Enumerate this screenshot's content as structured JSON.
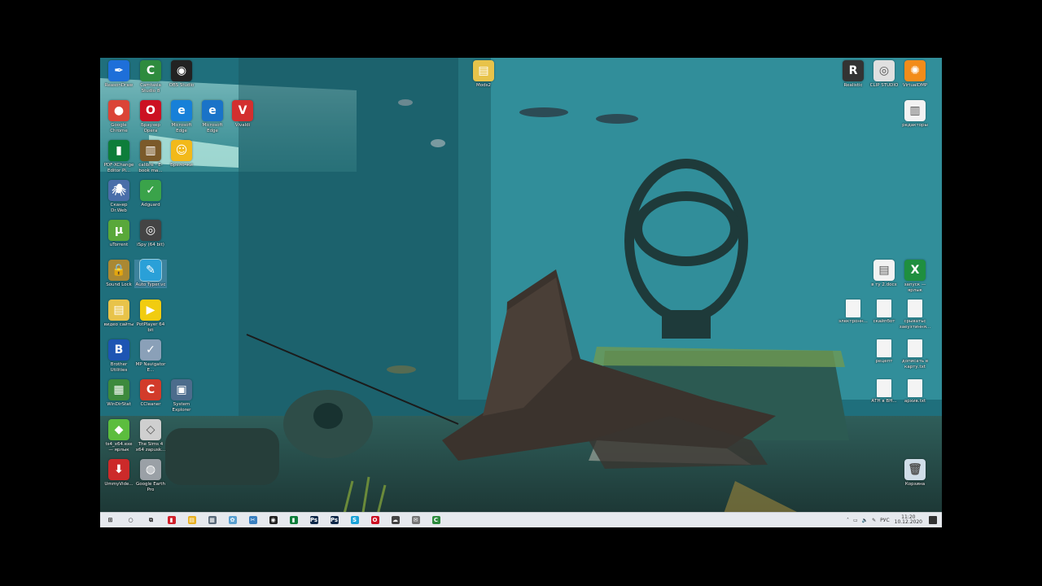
{
  "desktop": {
    "left_icons": [
      {
        "name": "Reason icon",
        "label": "ReasonDraw",
        "color": "#1e6fd9",
        "glyph": "✒"
      },
      {
        "name": "Camtasia",
        "label": "Camtasia Studio 8",
        "color": "#2e8b3e",
        "glyph": "C"
      },
      {
        "name": "OBS",
        "label": "OBS Studio",
        "color": "#222222",
        "glyph": "◉"
      },
      {
        "name": "Chrome",
        "label": "Google Chrome",
        "color": "#db4437",
        "glyph": "●"
      },
      {
        "name": "Opera",
        "label": "Браузер Opera",
        "color": "#cc1122",
        "glyph": "O"
      },
      {
        "name": "Edge",
        "label": "Microsoft Edge",
        "color": "#1780d8",
        "glyph": "e"
      },
      {
        "name": "IE",
        "label": "Microsoft Edge",
        "color": "#1a73c8",
        "glyph": "e"
      },
      {
        "name": "Vivaldi",
        "label": "Vivaldi",
        "color": "#d32f2f",
        "glyph": "V"
      },
      {
        "name": "Foxit",
        "label": "PDF-XChange Editor Pl...",
        "color": "#0d7d3a",
        "glyph": "▮"
      },
      {
        "name": "Calibre",
        "label": "calibre - E-book ma...",
        "color": "#7b5a2a",
        "glyph": "▥"
      },
      {
        "name": "Smile",
        "label": "Брелочки",
        "color": "#f2b91a",
        "glyph": "☺"
      },
      {
        "name": "DrWeb",
        "label": "Сканер Dr.Web",
        "color": "#4a6ea9",
        "glyph": "🕷"
      },
      {
        "name": "Adguard",
        "label": "Adguard",
        "color": "#3aa34a",
        "glyph": "✓"
      },
      {
        "name": "uTorrent",
        "label": "uTorrent",
        "color": "#59a83a",
        "glyph": "µ"
      },
      {
        "name": "iSpy",
        "label": "iSpy (64 bit)",
        "color": "#444444",
        "glyph": "◎"
      },
      {
        "name": "SoundLock",
        "label": "Sound Lock",
        "color": "#aa8833",
        "glyph": "🔒"
      },
      {
        "name": "AutoTyper",
        "label": "Auto Typer.vc",
        "color": "#2aa0d8",
        "glyph": "✎"
      },
      {
        "name": "VideoFolder",
        "label": "видео сайты",
        "color": "#e8c34a",
        "glyph": "▤"
      },
      {
        "name": "PotPlayer",
        "label": "PotPlayer 64 bit",
        "color": "#f1cc10",
        "glyph": "▶"
      },
      {
        "name": "Brother",
        "label": "Brother Utilities",
        "color": "#1d55b3",
        "glyph": "B"
      },
      {
        "name": "MP",
        "label": "MP Navigator E...",
        "color": "#8aa0b8",
        "glyph": "✓"
      },
      {
        "name": "WinDirStat",
        "label": "WinDirStat",
        "color": "#3d8a3d",
        "glyph": "▦"
      },
      {
        "name": "CCleaner",
        "label": "CCleaner",
        "color": "#d23b2a",
        "glyph": "C"
      },
      {
        "name": "SysExplorer",
        "label": "System Explorer",
        "color": "#4c6c8c",
        "glyph": "▣"
      },
      {
        "name": "Sims1",
        "label": "ts4_x64.exe — ярлык",
        "color": "#5cbd3e",
        "glyph": "◆"
      },
      {
        "name": "Sims2",
        "label": "The Sims 4 x64 zapusk...",
        "color": "#cfcfcf",
        "glyph": "◇"
      },
      {
        "name": "UmmyVideo",
        "label": "UmmyVide...",
        "color": "#cc2a2a",
        "glyph": "⬇"
      },
      {
        "name": "GoogleEarth",
        "label": "Google Earth Pro",
        "color": "#9aa0a6",
        "glyph": "◍"
      }
    ],
    "top_center_icon": {
      "label": "Mods2",
      "glyph": "▤",
      "color": "#e8c34a"
    },
    "right_icons": [
      {
        "name": "Reaper",
        "label": "Realistic",
        "color": "#333333",
        "glyph": "R"
      },
      {
        "name": "ClipStudio",
        "label": "CLIP STUDIO",
        "color": "#e0e0e0",
        "glyph": "◎"
      },
      {
        "name": "VirtualDub",
        "label": "VirtualDMP",
        "color": "#f28c1a",
        "glyph": "✺"
      },
      {
        "name": "Redaktor",
        "label": "редакторы",
        "color": "#f2f2f2",
        "glyph": "▥"
      },
      {
        "name": "Docx1",
        "label": "в ту 2.docx",
        "color": "#f2f2f2",
        "glyph": "▤"
      },
      {
        "name": "Xls1",
        "label": "запуск — ярлык",
        "color": "#1f8f3f",
        "glyph": "X"
      },
      {
        "name": "File1",
        "label": "электронн...",
        "color": "#f4f4f4",
        "glyph": ""
      },
      {
        "name": "File2",
        "label": "скайпбот",
        "color": "#f4f4f4",
        "glyph": ""
      },
      {
        "name": "File3",
        "label": "срыватьс заеузтиння...",
        "color": "#f4f4f4",
        "glyph": ""
      },
      {
        "name": "File4",
        "label": "рецепт",
        "color": "#f4f4f4",
        "glyph": ""
      },
      {
        "name": "File5",
        "label": "дописать в карту.txt",
        "color": "#f4f4f4",
        "glyph": ""
      },
      {
        "name": "File6",
        "label": "АТН в ВН...",
        "color": "#f4f4f4",
        "glyph": ""
      },
      {
        "name": "File7",
        "label": "архив.txt",
        "color": "#f4f4f4",
        "glyph": ""
      },
      {
        "name": "Recycle",
        "label": "Корзина",
        "color": "#d0dde8",
        "glyph": "🗑"
      }
    ]
  },
  "taskbar": {
    "items": [
      {
        "name": "start",
        "glyph": "⊞",
        "color": "#1c1c1c"
      },
      {
        "name": "search",
        "glyph": "○",
        "color": "#1c1c1c"
      },
      {
        "name": "taskview",
        "glyph": "⧉",
        "color": "#1c1c1c"
      },
      {
        "name": "ummy",
        "glyph": "▮",
        "color": "#d0202a"
      },
      {
        "name": "explorer",
        "glyph": "▤",
        "color": "#e8b020"
      },
      {
        "name": "calc",
        "glyph": "▦",
        "color": "#5a6a7a"
      },
      {
        "name": "paint",
        "glyph": "✿",
        "color": "#5aa0d0"
      },
      {
        "name": "snip",
        "glyph": "✂",
        "color": "#3a80c0"
      },
      {
        "name": "obs",
        "glyph": "◉",
        "color": "#222222"
      },
      {
        "name": "foxit",
        "glyph": "▮",
        "color": "#0d7d3a"
      },
      {
        "name": "photoshop",
        "glyph": "Ps",
        "color": "#0f2a4a"
      },
      {
        "name": "photoshop2",
        "glyph": "Ps",
        "color": "#0f2a4a"
      },
      {
        "name": "skype",
        "glyph": "S",
        "color": "#1aa3d8"
      },
      {
        "name": "opera",
        "glyph": "O",
        "color": "#cc1122"
      },
      {
        "name": "chat",
        "glyph": "☁",
        "color": "#444444"
      },
      {
        "name": "mail",
        "glyph": "✉",
        "color": "#777777"
      },
      {
        "name": "camtasia",
        "glyph": "C",
        "color": "#2e8b3e"
      }
    ],
    "tray": {
      "lang": "РУС",
      "time": "11:20",
      "date": "10.12.2020"
    }
  }
}
